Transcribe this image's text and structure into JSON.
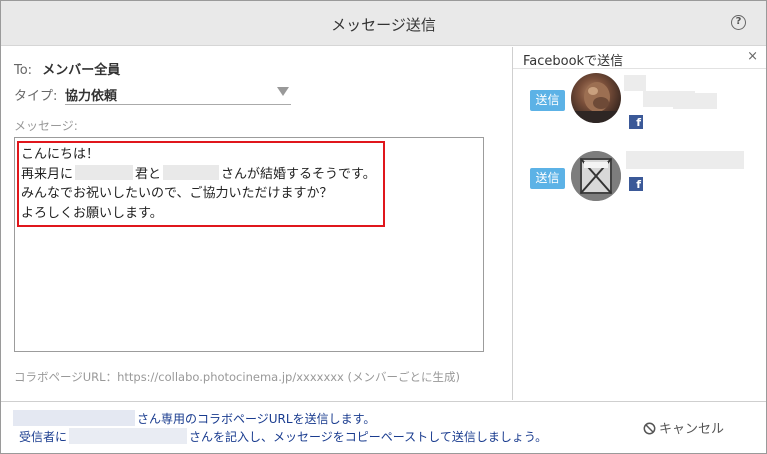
{
  "dialog": {
    "title": "メッセージ送信",
    "help_icon": "?"
  },
  "to": {
    "label": "To:",
    "value": "メンバー全員"
  },
  "type": {
    "label": "タイプ:",
    "selected": "協力依頼"
  },
  "message": {
    "label": "メッセージ:",
    "line1": "こんにちは！",
    "line2_a": "再来月に",
    "line2_b": "君と",
    "line2_c": "さんが結婚するそうです。",
    "line3": "みんなでお祝いしたいので、ご協力いただけますか？",
    "line4": "よろしくお願いします。"
  },
  "collabo_url": "コラボページURL：https://collabo.photocinema.jp/xxxxxxx (メンバーごとに生成)",
  "facebook_panel": {
    "title": "Facebookで送信",
    "close": "×",
    "contacts": [
      {
        "send_label": "送信",
        "fb_glyph": "f"
      },
      {
        "send_label": "送信",
        "fb_glyph": "f"
      }
    ]
  },
  "footer": {
    "line1": "さん専用のコラボページURLを送信します。",
    "line2_a": "受信者に",
    "line2_b": "さんを記入し、メッセージをコピーペーストして送信しましょう。",
    "cancel_label": "キャンセル"
  },
  "colors": {
    "accent_send": "#5cb2e6",
    "highlight_border": "#e0161c",
    "facebook": "#3b5998",
    "footer_text": "#1a3c8f"
  },
  "icons": {
    "help": "question-circle-icon",
    "close": "close-icon",
    "dropdown": "triangle-down-icon",
    "facebook": "facebook-icon",
    "cancel": "prohibited-icon"
  }
}
